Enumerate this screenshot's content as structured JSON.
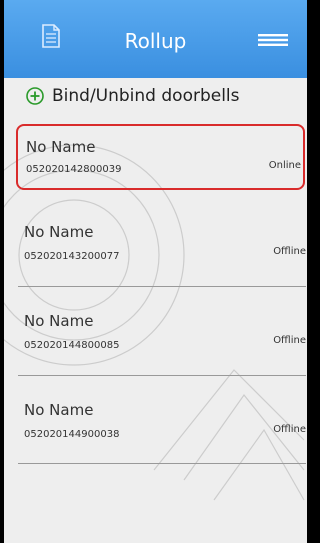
{
  "header": {
    "title": "Rollup"
  },
  "actions": {
    "bind_label": "Bind/Unbind doorbells"
  },
  "devices": [
    {
      "name": "No Name",
      "serial": "052020142800039",
      "status": "Online"
    },
    {
      "name": "No Name",
      "serial": "052020143200077",
      "status": "Offline"
    },
    {
      "name": "No Name",
      "serial": "052020144800085",
      "status": "Offline"
    },
    {
      "name": "No Name",
      "serial": "052020144900038",
      "status": "Offline"
    }
  ],
  "colors": {
    "header": "#3a8fe0",
    "selection_border": "#d92b2b",
    "plus_icon": "#2a9a2a"
  }
}
